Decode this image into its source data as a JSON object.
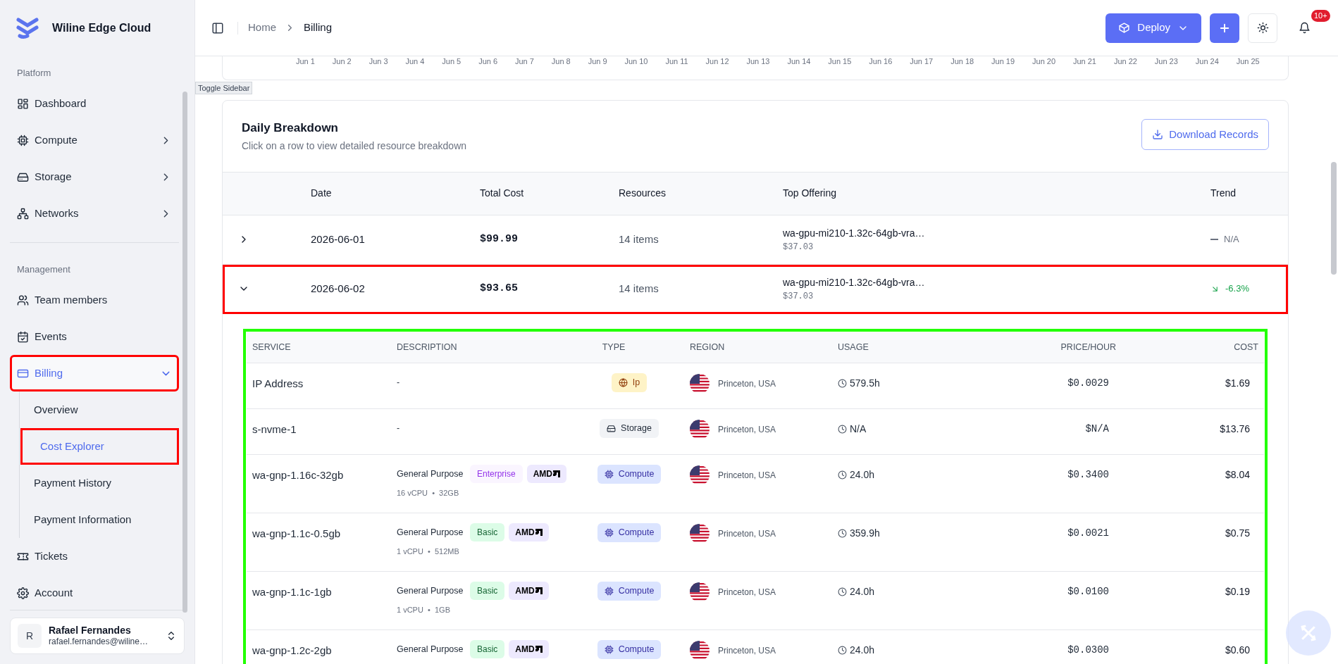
{
  "sidebar": {
    "brand": "Wiline Edge Cloud",
    "sections": [
      {
        "label": "Platform",
        "items": [
          {
            "label": "Dashboard",
            "has_submenu": false,
            "selected": false,
            "highlighted": false
          },
          {
            "label": "Compute",
            "has_submenu": true,
            "expanded": false,
            "selected": false,
            "highlighted": false
          },
          {
            "label": "Storage",
            "has_submenu": true,
            "expanded": false,
            "selected": false,
            "highlighted": false
          },
          {
            "label": "Networks",
            "has_submenu": true,
            "expanded": false,
            "selected": false,
            "highlighted": false
          }
        ]
      },
      {
        "label": "Management",
        "items": [
          {
            "label": "Team members",
            "has_submenu": false,
            "selected": false,
            "highlighted": false
          },
          {
            "label": "Events",
            "has_submenu": false,
            "selected": false,
            "highlighted": false
          },
          {
            "label": "Billing",
            "has_submenu": true,
            "expanded": true,
            "selected": true,
            "highlighted": true,
            "children": [
              {
                "label": "Overview",
                "selected": false,
                "highlighted": false
              },
              {
                "label": "Cost Explorer",
                "selected": true,
                "highlighted": true
              },
              {
                "label": "Payment History",
                "selected": false,
                "highlighted": false
              },
              {
                "label": "Payment Information",
                "selected": false,
                "highlighted": false
              }
            ]
          },
          {
            "label": "Tickets",
            "has_submenu": false,
            "selected": false,
            "highlighted": false
          },
          {
            "label": "Account",
            "has_submenu": false,
            "selected": false,
            "highlighted": false
          }
        ]
      }
    ],
    "user": {
      "initial": "R",
      "name": "Rafael Fernandes",
      "email": "rafael.fernandes@wiline…"
    }
  },
  "header": {
    "breadcrumb": [
      "Home",
      "Billing"
    ],
    "deploy_button": "Deploy",
    "notification_badge": "10+"
  },
  "tooltip": "Toggle Sidebar",
  "chart_axis_labels": [
    "Jun 1",
    "Jun 2",
    "Jun 3",
    "Jun 4",
    "Jun 5",
    "Jun 6",
    "Jun 7",
    "Jun 8",
    "Jun 9",
    "Jun 10",
    "Jun 11",
    "Jun 12",
    "Jun 13",
    "Jun 14",
    "Jun 15",
    "Jun 16",
    "Jun 17",
    "Jun 18",
    "Jun 19",
    "Jun 20",
    "Jun 21",
    "Jun 22",
    "Jun 23",
    "Jun 24",
    "Jun 25"
  ],
  "daily_breakdown": {
    "title": "Daily Breakdown",
    "subtitle": "Click on a row to view detailed resource breakdown",
    "download_button": "Download Records",
    "columns": [
      "Date",
      "Total Cost",
      "Resources",
      "Top Offering",
      "Trend"
    ],
    "rows": [
      {
        "date": "2026-06-01",
        "total_cost": "$99.99",
        "resources": "14 items",
        "top_offering": "wa-gpu-mi210-1.32c-64gb-vra…",
        "top_offering_cost": "$37.03",
        "trend": {
          "kind": "none",
          "label": "N/A"
        },
        "expanded": false,
        "highlighted": false
      },
      {
        "date": "2026-06-02",
        "total_cost": "$93.65",
        "resources": "14 items",
        "top_offering": "wa-gpu-mi210-1.32c-64gb-vra…",
        "top_offering_cost": "$37.03",
        "trend": {
          "kind": "down",
          "label": "-6.3%"
        },
        "expanded": true,
        "highlighted": true
      }
    ]
  },
  "detail_table": {
    "highlighted": true,
    "columns": [
      "SERVICE",
      "DESCRIPTION",
      "TYPE",
      "REGION",
      "USAGE",
      "PRICE/HOUR",
      "COST"
    ],
    "rows": [
      {
        "service": "IP Address",
        "description": "-",
        "tags": [],
        "type": {
          "kind": "ip",
          "label": "Ip"
        },
        "region": "Princeton, USA",
        "usage": "579.5h",
        "price": "$0.0029",
        "cost": "$1.69"
      },
      {
        "service": "s-nvme-1",
        "description": "-",
        "tags": [],
        "type": {
          "kind": "storage",
          "label": "Storage"
        },
        "region": "Princeton, USA",
        "usage": "N/A",
        "price": "$N/A",
        "cost": "$13.76"
      },
      {
        "service": "wa-gnp-1.16c-32gb",
        "description": "General Purpose",
        "specs": "16 vCPU  •  32GB",
        "tags": [
          {
            "kind": "enterprise",
            "label": "Enterprise"
          },
          {
            "kind": "amd",
            "label": "AMD"
          }
        ],
        "type": {
          "kind": "compute",
          "label": "Compute"
        },
        "region": "Princeton, USA",
        "usage": "24.0h",
        "price": "$0.3400",
        "cost": "$8.04"
      },
      {
        "service": "wa-gnp-1.1c-0.5gb",
        "description": "General Purpose",
        "specs": "1 vCPU  •  512MB",
        "tags": [
          {
            "kind": "basic",
            "label": "Basic"
          },
          {
            "kind": "amd",
            "label": "AMD"
          }
        ],
        "type": {
          "kind": "compute",
          "label": "Compute"
        },
        "region": "Princeton, USA",
        "usage": "359.9h",
        "price": "$0.0021",
        "cost": "$0.75"
      },
      {
        "service": "wa-gnp-1.1c-1gb",
        "description": "General Purpose",
        "specs": "1 vCPU  •  1GB",
        "tags": [
          {
            "kind": "basic",
            "label": "Basic"
          },
          {
            "kind": "amd",
            "label": "AMD"
          }
        ],
        "type": {
          "kind": "compute",
          "label": "Compute"
        },
        "region": "Princeton, USA",
        "usage": "24.0h",
        "price": "$0.0100",
        "cost": "$0.19"
      },
      {
        "service": "wa-gnp-1.2c-2gb",
        "description": "General Purpose",
        "tags": [
          {
            "kind": "basic",
            "label": "Basic"
          },
          {
            "kind": "amd",
            "label": "AMD"
          }
        ],
        "type": {
          "kind": "compute",
          "label": "Compute"
        },
        "region": "Princeton, USA",
        "usage": "24.0h",
        "price": "$0.0300",
        "cost": "$0.60"
      }
    ]
  }
}
